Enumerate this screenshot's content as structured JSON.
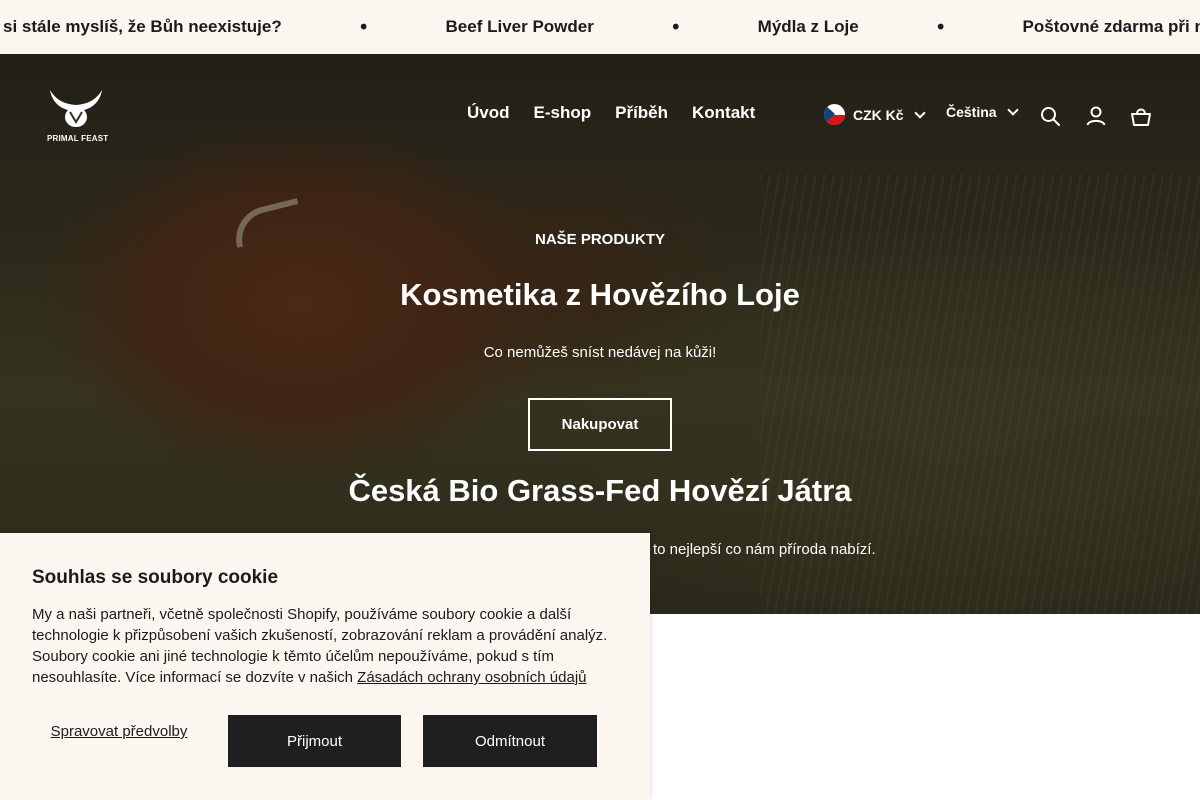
{
  "announcement": {
    "items": [
      "si stále myslíš, že Bůh neexistuje?",
      "Beef Liver Powder",
      "Mýdla z Loje",
      "Poštovné zdarma při nákupu na"
    ],
    "separator": "•"
  },
  "header": {
    "logo_text": "PRIMAL FEAST",
    "nav": [
      "Úvod",
      "E-shop",
      "Příběh",
      "Kontakt"
    ],
    "currency": "CZK Kč",
    "language": "Čeština",
    "icons": [
      "search-icon",
      "account-icon",
      "cart-icon"
    ]
  },
  "hero": {
    "kicker": "NAŠE PRODUKTY",
    "title": "Kosmetika z Hovězího Loje",
    "subtitle": "Co nemůžeš sníst nedávej na kůži!",
    "button": "Nakupovat",
    "next_title": "Česká Bio Grass-Fed Hovězí Játra",
    "next_subtitle_visible": "to nejlepší co nám příroda nabízí."
  },
  "cookie_banner": {
    "title": "Souhlas se soubory cookie",
    "body": "My a naši partneři, včetně společnosti Shopify, používáme soubory cookie a další technologie k přizpůsobení vašich zkušeností, zobrazování reklam a provádění analýz. Soubory cookie ani jiné technologie k těmto účelům nepoužíváme, pokud s tím nesouhlasíte. Více informací se dozvíte v našich",
    "link": "Zásadách ochrany osobních údajů",
    "manage": "Spravovat předvolby",
    "accept": "Přijmout",
    "decline": "Odmítnout"
  },
  "colors": {
    "banner_bg": "#fbf6ef",
    "button_dark": "#1f1f1f",
    "text_dark": "#1b1b1b"
  }
}
